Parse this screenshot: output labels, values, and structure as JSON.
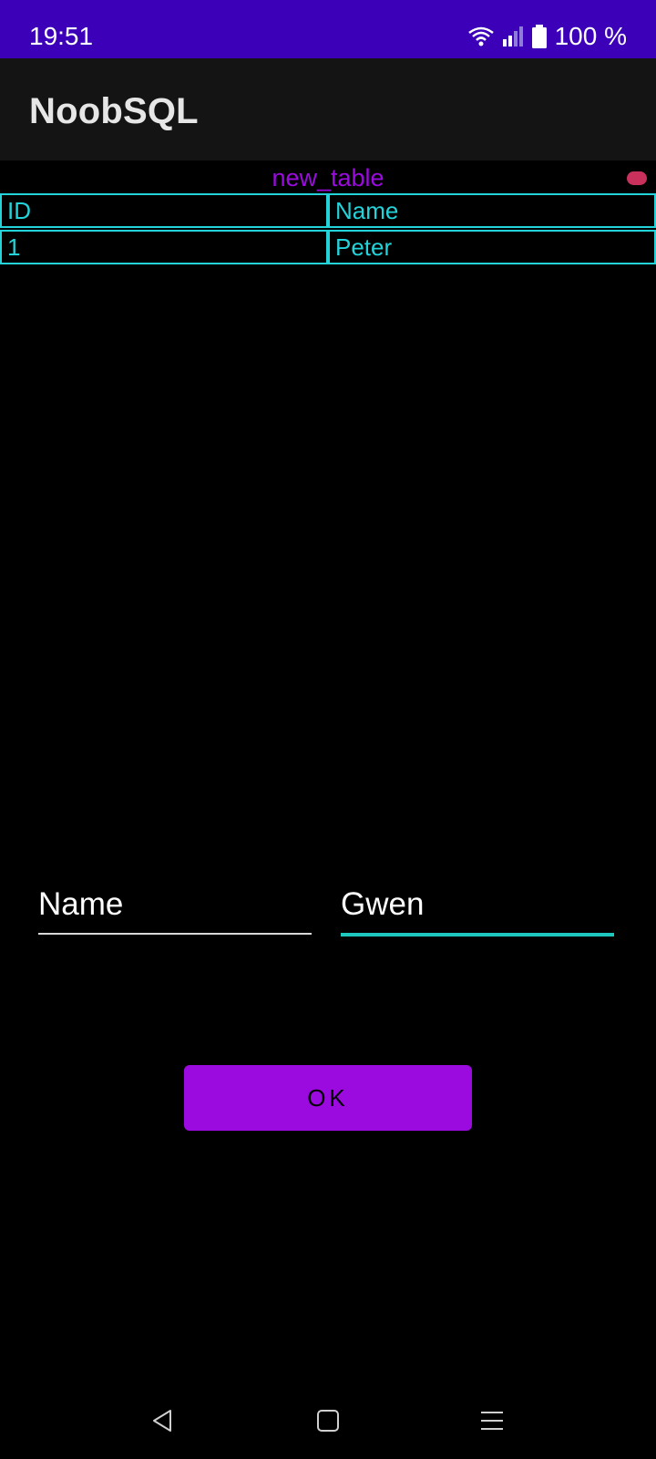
{
  "status_bar": {
    "time": "19:51",
    "battery_text": "100 %",
    "icons": [
      "wifi-icon",
      "signal-icon",
      "battery-icon"
    ]
  },
  "app_bar": {
    "title": "NoobSQL"
  },
  "table": {
    "name": "new_table",
    "columns": [
      "ID",
      "Name"
    ],
    "rows": [
      [
        "1",
        "Peter"
      ]
    ]
  },
  "form": {
    "column_name": "Name",
    "value": "Gwen",
    "ok_label": "OK"
  },
  "colors": {
    "status_bar": "#3b00b8",
    "accent_purple": "#9b0adf",
    "table_cyan": "#22d3d9",
    "input_focus": "#1ec8be",
    "record_dot": "#c9305b"
  },
  "nav_bar": {
    "icons": [
      "back-icon",
      "home-icon",
      "recents-icon"
    ]
  }
}
